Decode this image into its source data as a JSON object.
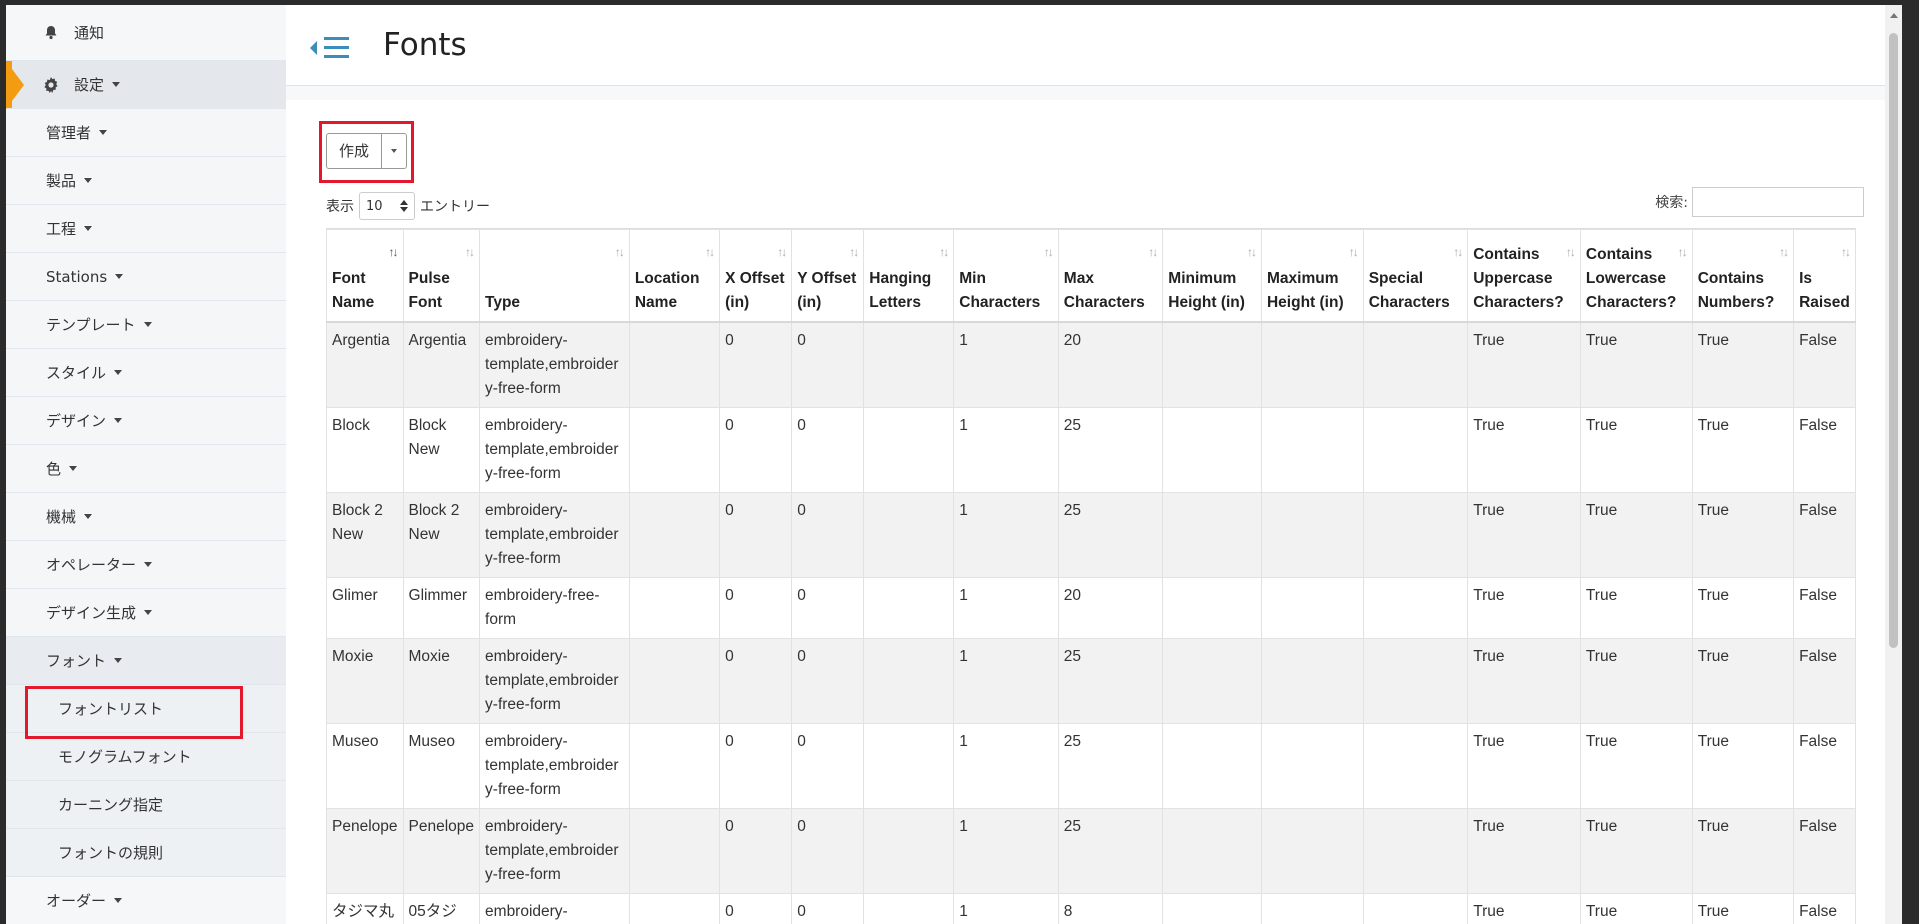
{
  "sidebar": {
    "notifications": "通知",
    "settings": "設定",
    "items": [
      {
        "label": "管理者"
      },
      {
        "label": "製品"
      },
      {
        "label": "工程"
      },
      {
        "label": "Stations"
      },
      {
        "label": "テンプレート"
      },
      {
        "label": "スタイル"
      },
      {
        "label": "デザイン"
      },
      {
        "label": "色"
      },
      {
        "label": "機械"
      },
      {
        "label": "オペレーター"
      },
      {
        "label": "デザイン生成"
      },
      {
        "label": "フォント"
      }
    ],
    "font_sub": [
      "フォントリスト",
      "モノグラムフォント",
      "カーニング指定",
      "フォントの規則"
    ],
    "orders": "オーダー"
  },
  "header": {
    "title": "Fonts"
  },
  "toolbar": {
    "create_label": "作成"
  },
  "table_controls": {
    "show_label": "表示",
    "page_length": "10",
    "entries_label": "エントリー",
    "search_label": "検索:"
  },
  "columns": [
    "Font Name",
    "Pulse Font",
    "Type",
    "Location Name",
    "X Offset (in)",
    "Y Offset (in)",
    "Hanging Letters",
    "Min Characters",
    "Max Characters",
    "Minimum Height (in)",
    "Maximum Height (in)",
    "Special Characters",
    "Contains Uppercase Characters?",
    "Contains Lowercase Characters?",
    "Contains Numbers?",
    "Is Raised"
  ],
  "rows": [
    [
      "Argentia",
      "Argentia",
      "embroidery-template,embroidery-free-form",
      "",
      "0",
      "0",
      "",
      "1",
      "20",
      "",
      "",
      "",
      "True",
      "True",
      "True",
      "False"
    ],
    [
      "Block",
      "Block New",
      "embroidery-template,embroidery-free-form",
      "",
      "0",
      "0",
      "",
      "1",
      "25",
      "",
      "",
      "",
      "True",
      "True",
      "True",
      "False"
    ],
    [
      "Block 2 New",
      "Block 2 New",
      "embroidery-template,embroidery-free-form",
      "",
      "0",
      "0",
      "",
      "1",
      "25",
      "",
      "",
      "",
      "True",
      "True",
      "True",
      "False"
    ],
    [
      "Glimer",
      "Glimmer",
      "embroidery-free-form",
      "",
      "0",
      "0",
      "",
      "1",
      "20",
      "",
      "",
      "",
      "True",
      "True",
      "True",
      "False"
    ],
    [
      "Moxie",
      "Moxie",
      "embroidery-template,embroidery-free-form",
      "",
      "0",
      "0",
      "",
      "1",
      "25",
      "",
      "",
      "",
      "True",
      "True",
      "True",
      "False"
    ],
    [
      "Museo",
      "Museo",
      "embroidery-template,embroidery-free-form",
      "",
      "0",
      "0",
      "",
      "1",
      "25",
      "",
      "",
      "",
      "True",
      "True",
      "True",
      "False"
    ],
    [
      "Penelope",
      "Penelope",
      "embroidery-template,embroidery-free-form",
      "",
      "0",
      "0",
      "",
      "1",
      "25",
      "",
      "",
      "",
      "True",
      "True",
      "True",
      "False"
    ],
    [
      "タジマ丸",
      "05タジ",
      "embroidery-",
      "",
      "0",
      "0",
      "",
      "1",
      "8",
      "",
      "",
      "",
      "True",
      "True",
      "True",
      "False"
    ]
  ],
  "colors": {
    "accent": "#f39c12",
    "highlight": "#e3182d",
    "brand_blue": "#3c8dbc"
  }
}
